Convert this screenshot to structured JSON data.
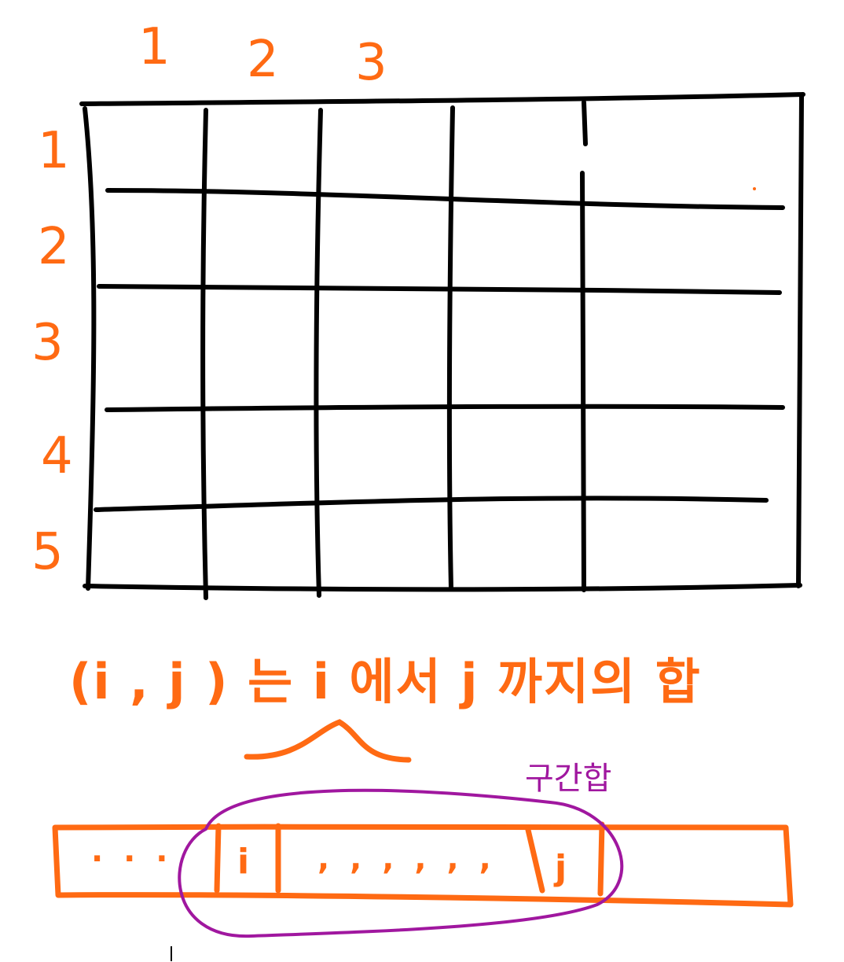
{
  "colors": {
    "ink": "#000000",
    "accent_orange": "#ff6a13",
    "accent_purple": "#a0179f"
  },
  "grid": {
    "column_labels": [
      "1",
      "2",
      "3"
    ],
    "row_labels": [
      "1",
      "2",
      "3",
      "4",
      "5"
    ]
  },
  "caption": {
    "text": "(i , j ) 는    i 에서 j 까지의 합"
  },
  "array_strip": {
    "leading_dots": ". .   .",
    "cell_i": "i",
    "middle_dots": ", , , , , ,",
    "cell_j": "j"
  },
  "range_annotation": {
    "label": "구간합"
  }
}
